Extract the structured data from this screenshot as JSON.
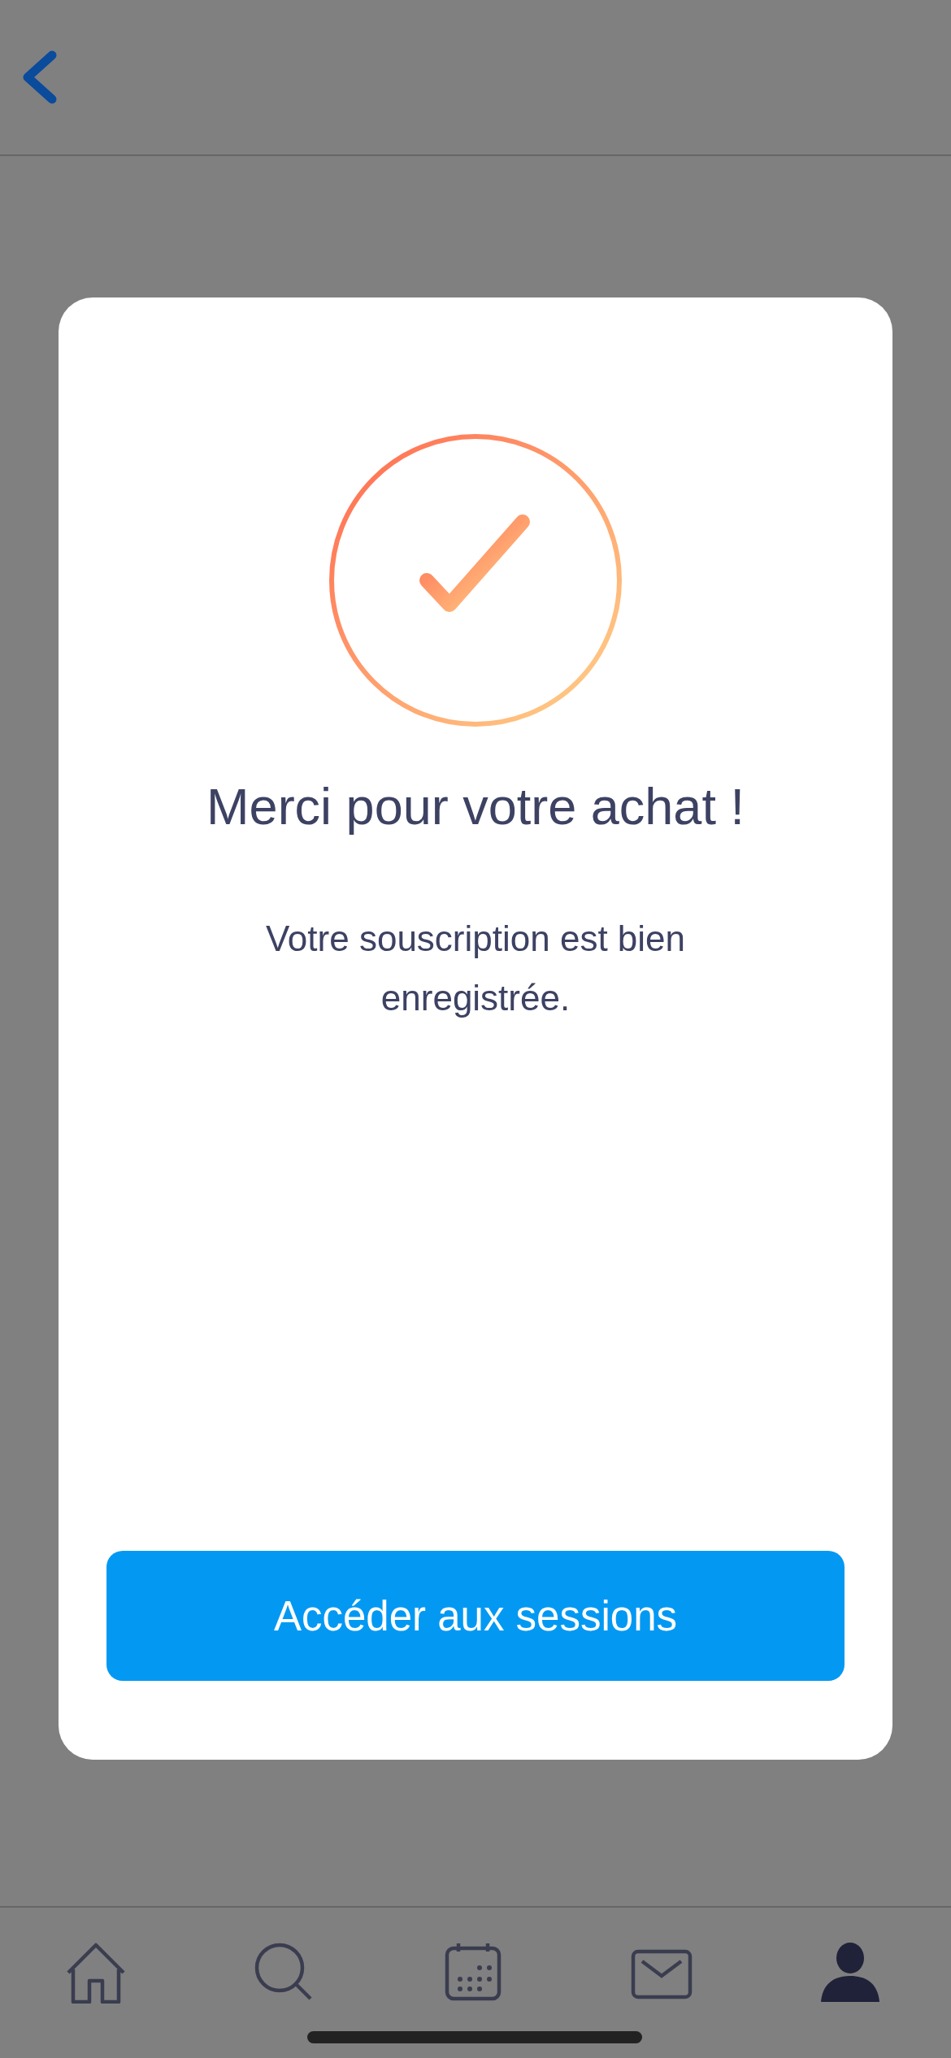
{
  "dialog": {
    "title": "Merci pour votre achat !",
    "message": "Votre souscription est bien enregistrée.",
    "button": "Accéder aux sessions"
  },
  "tab_bar": [
    {
      "kind": "home",
      "selected": false
    },
    {
      "kind": "search",
      "selected": false
    },
    {
      "kind": "calendar",
      "selected": false
    },
    {
      "kind": "mail",
      "selected": false
    },
    {
      "kind": "profile",
      "selected": true
    }
  ]
}
